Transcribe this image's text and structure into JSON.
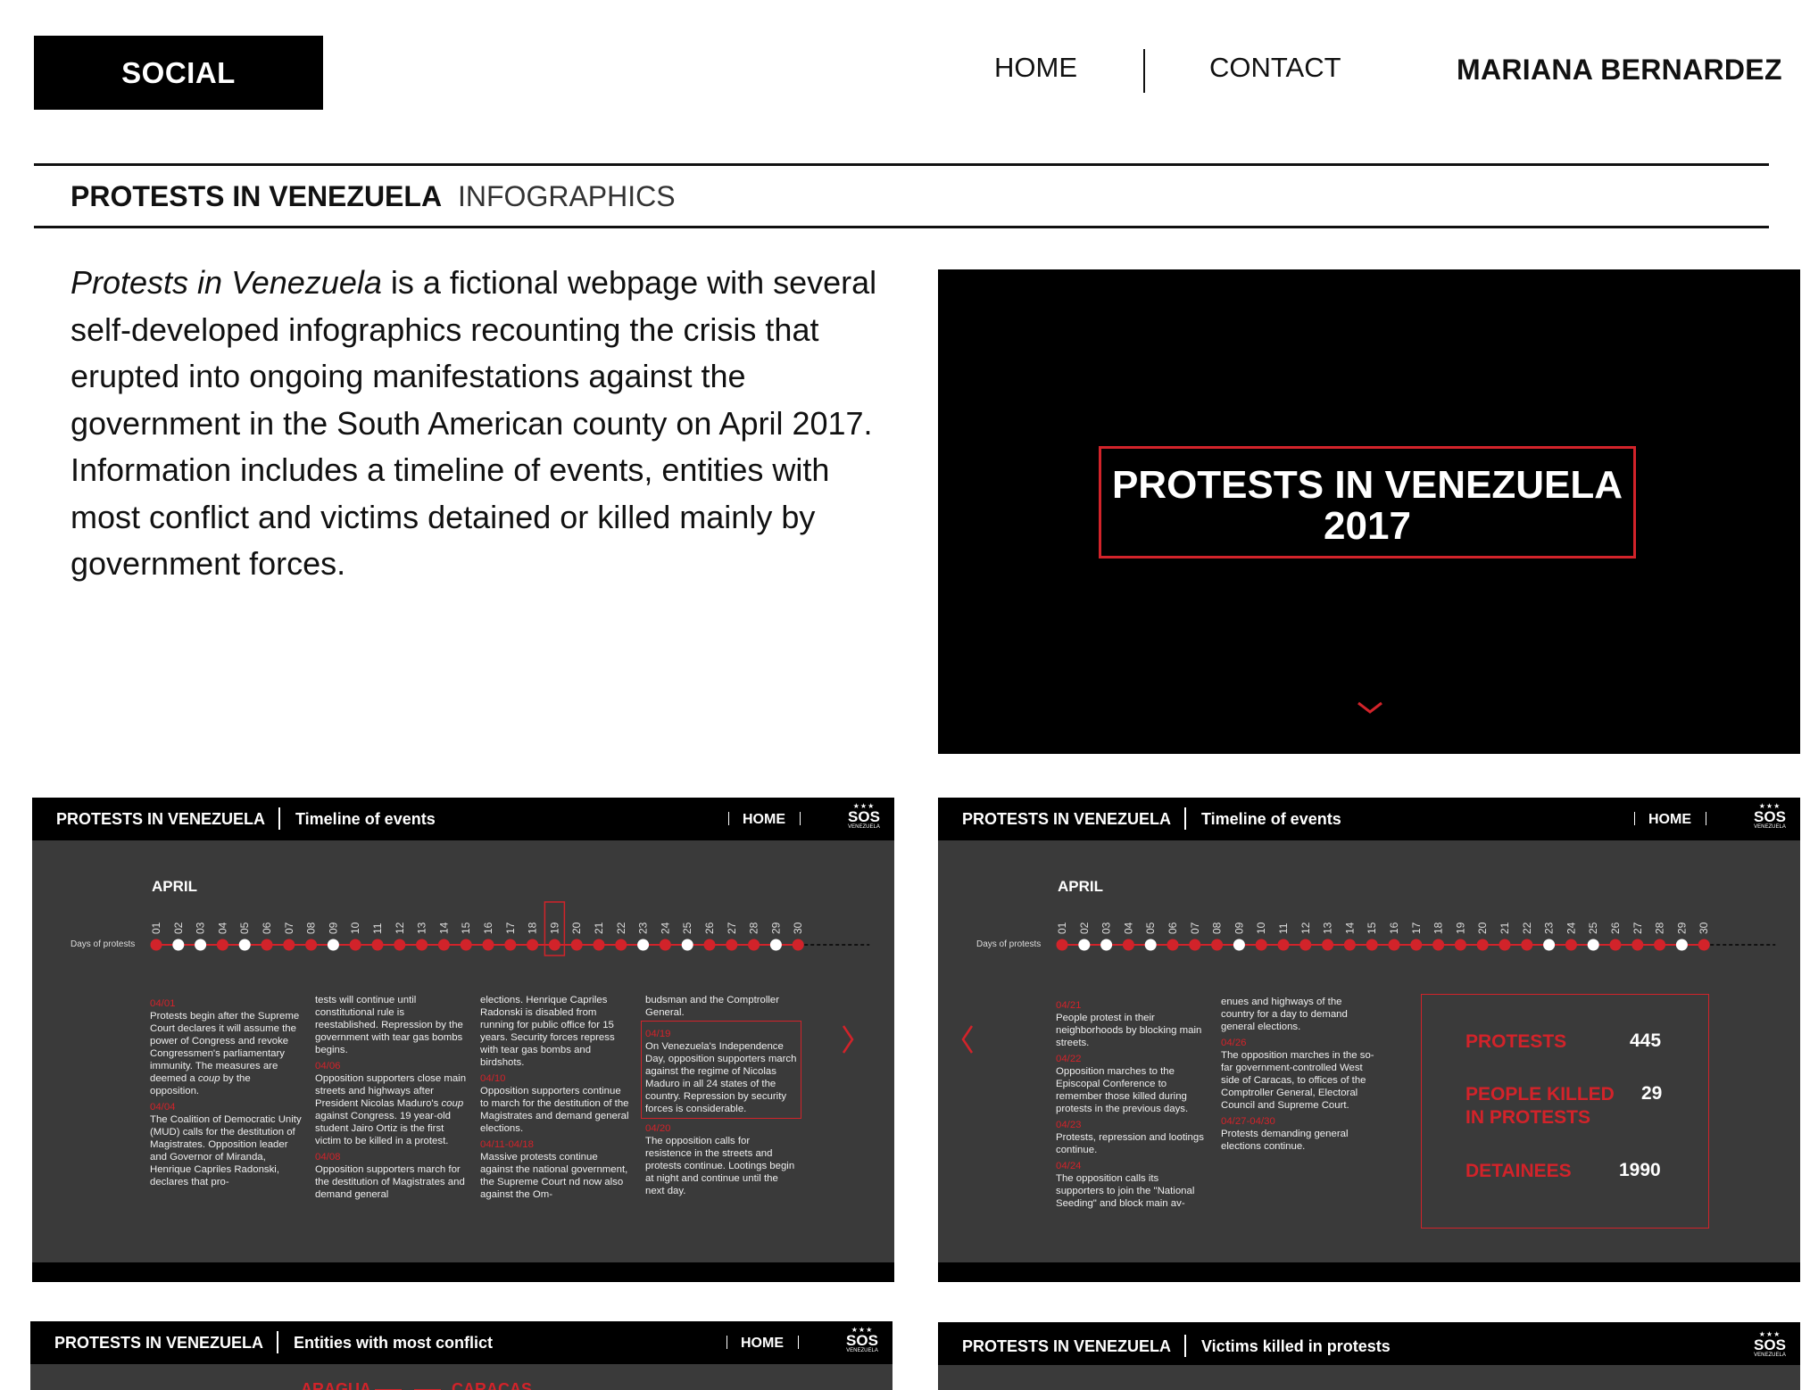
{
  "nav": {
    "social": "SOCIAL",
    "home": "HOME",
    "contact": "CONTACT",
    "author": "MARIANA BERNARDEZ"
  },
  "project": {
    "title": "PROTESTS IN VENEZUELA",
    "category": "INFOGRAPHICS",
    "desc_italic": "Protests in Venezuela",
    "desc_rest": " is a fictional webpage with several self-developed infographics recounting the crisis that erupted into ongoing manifestations against the government in the South American county on April 2017. Information includes a timeline of events, entities with most conflict and victims detained or killed mainly by government forces."
  },
  "hero": {
    "line1": "PROTESTS IN VENEZUELA",
    "line2": "2017"
  },
  "colors": {
    "accent": "#d2232a",
    "panel_bg": "#3a3a3a",
    "bar_bg": "#000000"
  },
  "site": {
    "title": "PROTESTS IN VENEZUELA",
    "home": "HOME",
    "sos": "SOS",
    "sos_sub": "VENEZUELA",
    "stars": "★★★"
  },
  "timeline1": {
    "subtitle": "Timeline of events",
    "month": "APRIL",
    "days_label": "Days of protests",
    "highlight_day": "19",
    "columns": [
      [
        {
          "date": "04/01",
          "text": "Protests begin after the Supreme Court declares it will assume the power of Congress and revoke Congressmen's parliamentary immunity. The measures are deemed a ",
          "italic": "coup",
          "after": " by the opposition."
        },
        {
          "date": "04/04",
          "text": "The Coalition of Democratic Unity (MUD) calls for the destitution of Magistrates. Opposition leader and Governor of Miranda, Henrique Capriles Radonski, declares that pro-"
        }
      ],
      [
        {
          "date": "",
          "text": "tests will continue until constitutional rule is reestablished. Repression by the government with tear gas bombs begins."
        },
        {
          "date": "04/06",
          "text": "Opposition supporters close main streets and highways after President Nicolas Maduro's ",
          "italic": "coup",
          "after": " against Congress. 19 year-old student Jairo Ortiz is the first victim to be killed in a protest."
        },
        {
          "date": "04/08",
          "text": "Opposition supporters march for the destitution of Magistrates and demand general"
        }
      ],
      [
        {
          "date": "",
          "text": "elections. Henrique Capriles Radonski is disabled from running for public office for 15 years. Security forces repress with tear gas bombs and birdshots."
        },
        {
          "date": "04/10",
          "text": "Opposition supporters continue to march for the destitution of the Magistrates and demand general elections."
        },
        {
          "date": "04/11-04/18",
          "text": "Massive protests continue against the national government, the Supreme Court nd now also against the Om-"
        }
      ],
      [
        {
          "date": "",
          "text": "budsman and the Comptroller General."
        },
        {
          "date": "04/19",
          "text": "On Venezuela's Independence Day, opposition supporters march against the regime of Nicolas Maduro in all 24 states of the country. Repression by security forces is considerable.",
          "boxed": true
        },
        {
          "date": "04/20",
          "text": "The opposition calls for resistence in the streets and protests continue. Lootings begin at night and continue until the next day."
        }
      ]
    ]
  },
  "timeline2": {
    "subtitle": "Timeline of events",
    "month": "APRIL",
    "days_label": "Days of protests",
    "columns": [
      [
        {
          "date": "04/21",
          "text": "People protest in their neighborhoods by blocking main streets."
        },
        {
          "date": "04/22",
          "text": "Opposition marches to the Episcopal Conference to remember those killed during protests in the previous days."
        },
        {
          "date": "04/23",
          "text": "Protests, repression and lootings continue."
        },
        {
          "date": "04/24",
          "text": "The opposition calls its supporters to join the \"National Seeding\" and block main av-"
        }
      ],
      [
        {
          "date": "",
          "text": "enues and highways of the country for a day to demand general elections."
        },
        {
          "date": "04/26",
          "text": "The opposition marches in the so-far government-controlled West side of Caracas, to offices of the Comptroller General, Electoral Council and Supreme Court."
        },
        {
          "date": "04/27-04/30",
          "text": "Protests demanding general elections continue."
        }
      ]
    ],
    "stats": [
      {
        "label": "PROTESTS",
        "value": "445"
      },
      {
        "label": "PEOPLE KILLED IN PROTESTS",
        "value": "29"
      },
      {
        "label": "DETAINEES",
        "value": "1990"
      }
    ]
  },
  "days": {
    "numbers": [
      "01",
      "02",
      "03",
      "04",
      "05",
      "06",
      "07",
      "08",
      "09",
      "10",
      "11",
      "12",
      "13",
      "14",
      "15",
      "16",
      "17",
      "18",
      "19",
      "20",
      "21",
      "22",
      "23",
      "24",
      "25",
      "26",
      "27",
      "28",
      "29",
      "30"
    ],
    "white_days": [
      "02",
      "03",
      "05",
      "09",
      "23",
      "25",
      "29"
    ]
  },
  "panel3": {
    "subtitle": "Entities with most conflict",
    "cities": [
      "ARAGUA",
      "CARACAS"
    ]
  },
  "panel4": {
    "subtitle": "Victims killed in protests"
  }
}
